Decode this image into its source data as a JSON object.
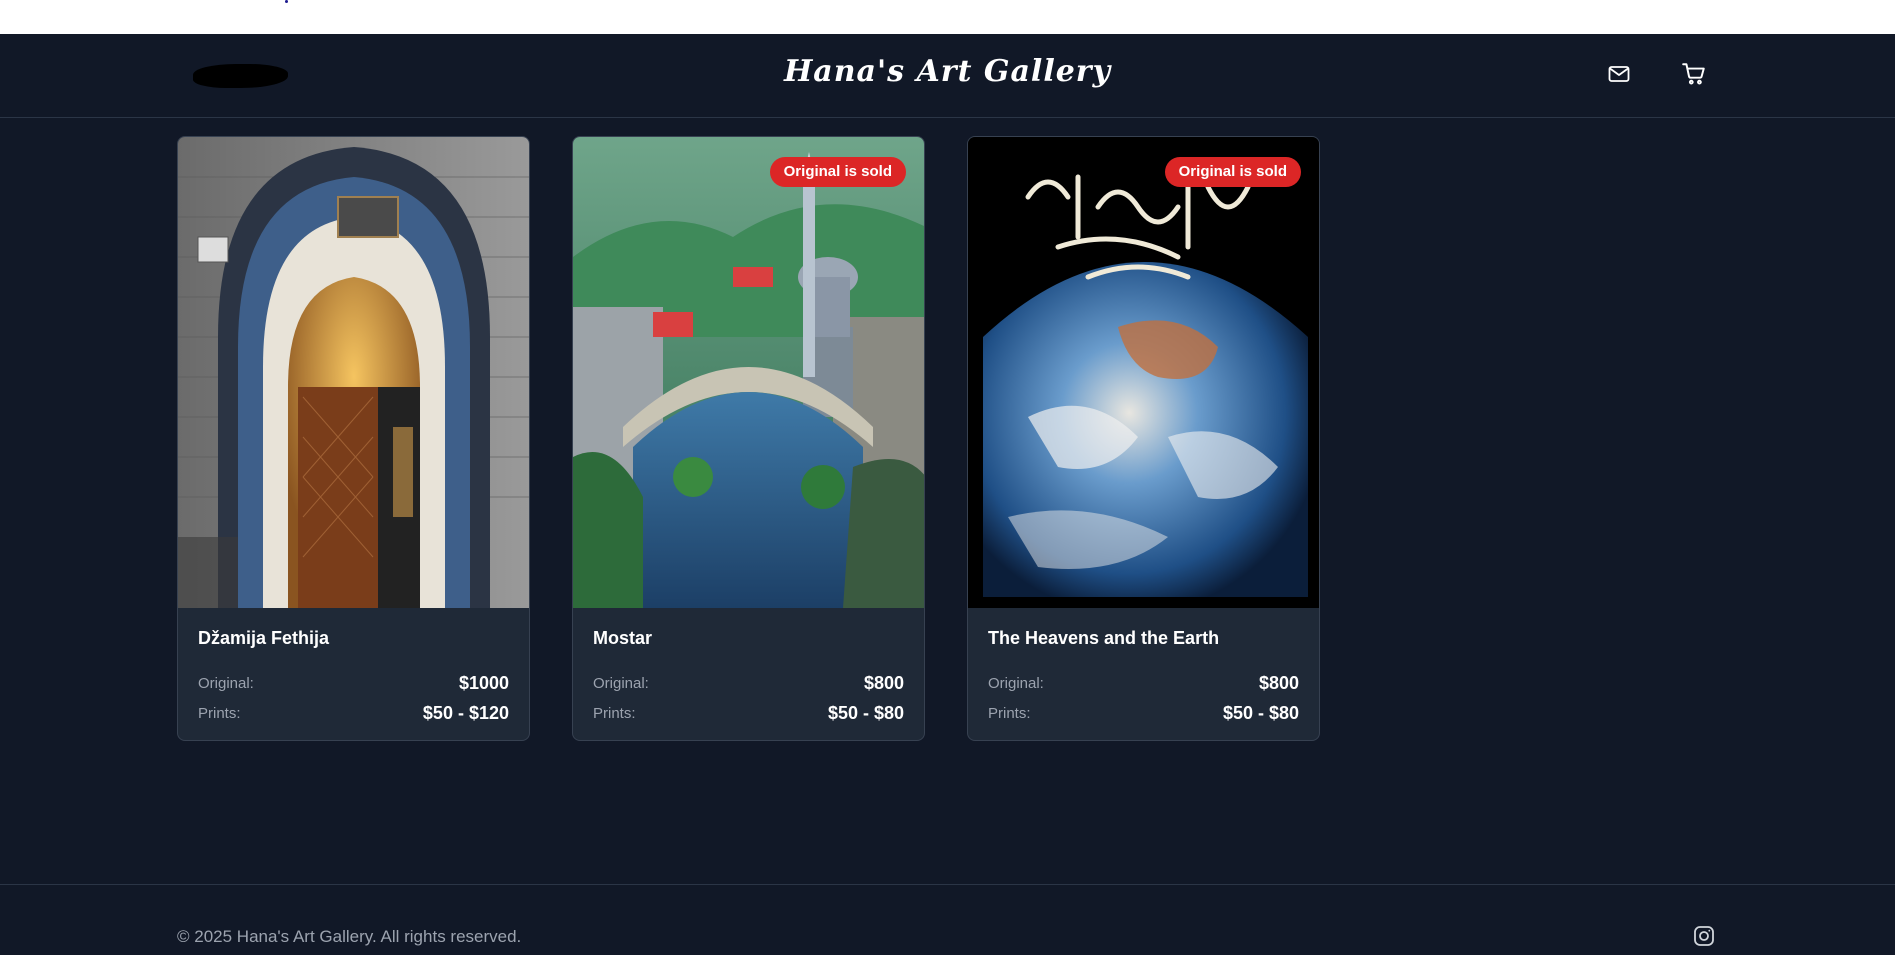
{
  "header": {
    "title": "Hana's Art Gallery",
    "icons": [
      "mail-icon",
      "cart-icon"
    ]
  },
  "artworks": [
    {
      "title": "Džamija Fethija",
      "original_label": "Original:",
      "original_price": "$1000",
      "prints_label": "Prints:",
      "prints_price": "$50 - $120",
      "badge": ""
    },
    {
      "title": "Mostar",
      "original_label": "Original:",
      "original_price": "$800",
      "prints_label": "Prints:",
      "prints_price": "$50 - $80",
      "badge": "Original is sold"
    },
    {
      "title": "The Heavens and the Earth",
      "original_label": "Original:",
      "original_price": "$800",
      "prints_label": "Prints:",
      "prints_price": "$50 - $80",
      "badge": "Original is sold"
    }
  ],
  "footer": {
    "copyright": "© 2025 Hana's Art Gallery. All rights reserved.",
    "icon": "instagram-icon"
  },
  "colors": {
    "background": "#111827",
    "card": "#1f2937",
    "badge": "#dc2626",
    "muted_text": "#9ca3af"
  }
}
